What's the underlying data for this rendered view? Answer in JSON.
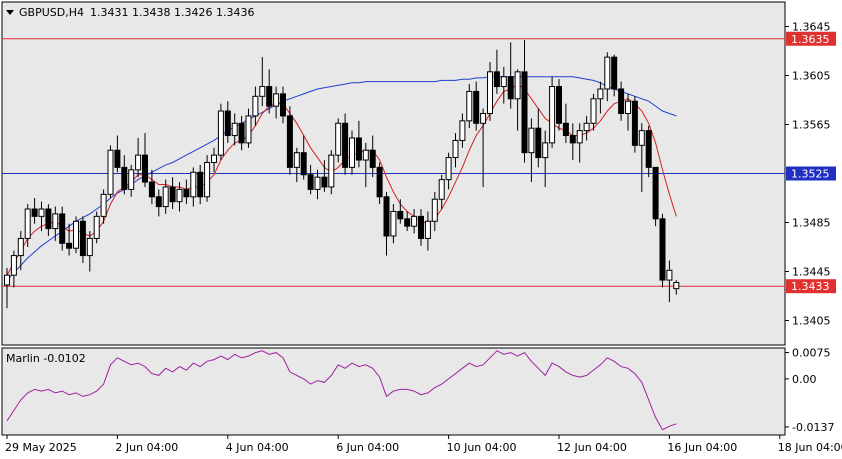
{
  "header": {
    "symbol": "GBPUSD,H4",
    "ohlc": "1.3431 1.3438 1.3426 1.3436"
  },
  "indicator_label": "Marlin -0.0102",
  "colors": {
    "bull_candle": "#ffffff",
    "bear_candle": "#000000",
    "red_line": "#e03030",
    "blue_line": "#2030c0",
    "ma_slow": "#1f3fd0",
    "ma_fast": "#d42020",
    "oscillator": "#a020a0"
  },
  "chart_data": [
    {
      "type": "candlestick",
      "title": "GBPUSD,H4",
      "ylim": [
        1.3385,
        1.3665
      ],
      "y_ticks": [
        "1.3645",
        "1.3605",
        "1.3565",
        "1.3485",
        "1.3445",
        "1.3405"
      ],
      "x_ticks": [
        "29 May 2025",
        "2 Jun 04:00",
        "4 Jun 04:00",
        "6 Jun 04:00",
        "10 Jun 04:00",
        "12 Jun 04:00",
        "16 Jun 04:00",
        "18 Jun 04:00"
      ],
      "x_tick_index": [
        0,
        16,
        32,
        48,
        64,
        80,
        96,
        112
      ],
      "horizontal_lines": [
        {
          "value": 1.3635,
          "label": "1.3635",
          "color": "#e03030"
        },
        {
          "value": 1.3525,
          "label": "1.3525",
          "color": "#2030c0"
        },
        {
          "value": 1.3433,
          "label": "1.3433",
          "color": "#e03030"
        }
      ],
      "candles": [
        [
          1.3434,
          1.3448,
          1.3415,
          1.3442
        ],
        [
          1.3442,
          1.3462,
          1.3432,
          1.3458
        ],
        [
          1.3458,
          1.3478,
          1.3446,
          1.3472
        ],
        [
          1.3472,
          1.35,
          1.3465,
          1.3496
        ],
        [
          1.3496,
          1.3505,
          1.3484,
          1.349
        ],
        [
          1.349,
          1.3502,
          1.3478,
          1.3496
        ],
        [
          1.3496,
          1.35,
          1.3474,
          1.348
        ],
        [
          1.348,
          1.3498,
          1.347,
          1.3492
        ],
        [
          1.3492,
          1.3498,
          1.3462,
          1.3468
        ],
        [
          1.3468,
          1.3484,
          1.3458,
          1.3464
        ],
        [
          1.3464,
          1.349,
          1.346,
          1.3486
        ],
        [
          1.3486,
          1.349,
          1.3452,
          1.3458
        ],
        [
          1.3458,
          1.3478,
          1.3445,
          1.3472
        ],
        [
          1.3472,
          1.3494,
          1.3468,
          1.349
        ],
        [
          1.349,
          1.3512,
          1.3484,
          1.3508
        ],
        [
          1.3508,
          1.3548,
          1.3505,
          1.3544
        ],
        [
          1.3544,
          1.3556,
          1.3526,
          1.353
        ],
        [
          1.353,
          1.354,
          1.3508,
          1.3512
        ],
        [
          1.3512,
          1.3532,
          1.3506,
          1.3528
        ],
        [
          1.3528,
          1.3554,
          1.3522,
          1.354
        ],
        [
          1.354,
          1.3558,
          1.3514,
          1.3518
        ],
        [
          1.3518,
          1.3528,
          1.35,
          1.3506
        ],
        [
          1.3506,
          1.3512,
          1.349,
          1.3498
        ],
        [
          1.3498,
          1.352,
          1.3492,
          1.3514
        ],
        [
          1.3514,
          1.3522,
          1.3496,
          1.3502
        ],
        [
          1.3502,
          1.3518,
          1.3494,
          1.3512
        ],
        [
          1.3512,
          1.352,
          1.35,
          1.3506
        ],
        [
          1.3506,
          1.353,
          1.3498,
          1.3526
        ],
        [
          1.3526,
          1.3532,
          1.35,
          1.3506
        ],
        [
          1.3506,
          1.354,
          1.3502,
          1.3534
        ],
        [
          1.3534,
          1.3546,
          1.3526,
          1.354
        ],
        [
          1.354,
          1.3582,
          1.3536,
          1.3576
        ],
        [
          1.3576,
          1.3584,
          1.355,
          1.3556
        ],
        [
          1.3556,
          1.3574,
          1.3548,
          1.3566
        ],
        [
          1.3566,
          1.3572,
          1.3544,
          1.355
        ],
        [
          1.355,
          1.3578,
          1.3546,
          1.3572
        ],
        [
          1.3572,
          1.3596,
          1.3564,
          1.3588
        ],
        [
          1.3588,
          1.362,
          1.358,
          1.3596
        ],
        [
          1.3596,
          1.361,
          1.3574,
          1.358
        ],
        [
          1.358,
          1.3596,
          1.357,
          1.359
        ],
        [
          1.359,
          1.3596,
          1.3566,
          1.3572
        ],
        [
          1.3572,
          1.358,
          1.3524,
          1.353
        ],
        [
          1.353,
          1.3546,
          1.3518,
          1.3542
        ],
        [
          1.3542,
          1.3556,
          1.352,
          1.3524
        ],
        [
          1.3524,
          1.3532,
          1.3508,
          1.3512
        ],
        [
          1.3512,
          1.3528,
          1.3504,
          1.3522
        ],
        [
          1.3522,
          1.3536,
          1.351,
          1.3514
        ],
        [
          1.3514,
          1.3544,
          1.3508,
          1.354
        ],
        [
          1.354,
          1.357,
          1.3534,
          1.3566
        ],
        [
          1.3566,
          1.3574,
          1.3524,
          1.353
        ],
        [
          1.353,
          1.356,
          1.3524,
          1.3554
        ],
        [
          1.3554,
          1.3568,
          1.353,
          1.3536
        ],
        [
          1.3536,
          1.355,
          1.3514,
          1.3544
        ],
        [
          1.3544,
          1.3556,
          1.3522,
          1.353
        ],
        [
          1.353,
          1.3534,
          1.35,
          1.3506
        ],
        [
          1.3506,
          1.351,
          1.3458,
          1.3474
        ],
        [
          1.3474,
          1.35,
          1.3468,
          1.3494
        ],
        [
          1.3494,
          1.3504,
          1.3484,
          1.3488
        ],
        [
          1.3488,
          1.3494,
          1.3478,
          1.3482
        ],
        [
          1.3482,
          1.3496,
          1.3476,
          1.349
        ],
        [
          1.349,
          1.3496,
          1.3466,
          1.3472
        ],
        [
          1.3472,
          1.3494,
          1.3462,
          1.3486
        ],
        [
          1.3486,
          1.351,
          1.3478,
          1.3504
        ],
        [
          1.3504,
          1.3524,
          1.3496,
          1.352
        ],
        [
          1.352,
          1.3542,
          1.3512,
          1.3538
        ],
        [
          1.3538,
          1.3558,
          1.353,
          1.3552
        ],
        [
          1.3552,
          1.3574,
          1.3546,
          1.3568
        ],
        [
          1.3568,
          1.3598,
          1.3562,
          1.3592
        ],
        [
          1.3592,
          1.36,
          1.356,
          1.3566
        ],
        [
          1.3566,
          1.3578,
          1.3514,
          1.3574
        ],
        [
          1.3574,
          1.3616,
          1.3568,
          1.3608
        ],
        [
          1.3608,
          1.3626,
          1.359,
          1.3596
        ],
        [
          1.3596,
          1.3612,
          1.3582,
          1.3604
        ],
        [
          1.3604,
          1.3632,
          1.3578,
          1.3586
        ],
        [
          1.3586,
          1.361,
          1.356,
          1.3608
        ],
        [
          1.3608,
          1.3634,
          1.3534,
          1.3542
        ],
        [
          1.3542,
          1.357,
          1.3518,
          1.3562
        ],
        [
          1.3562,
          1.3578,
          1.353,
          1.3538
        ],
        [
          1.3538,
          1.356,
          1.3514,
          1.355
        ],
        [
          1.355,
          1.3604,
          1.3546,
          1.3596
        ],
        [
          1.3596,
          1.3602,
          1.356,
          1.3566
        ],
        [
          1.3566,
          1.3582,
          1.355,
          1.3556
        ],
        [
          1.3556,
          1.3566,
          1.3536,
          1.355
        ],
        [
          1.355,
          1.3566,
          1.3534,
          1.356
        ],
        [
          1.356,
          1.3572,
          1.3552,
          1.3566
        ],
        [
          1.3566,
          1.359,
          1.356,
          1.3586
        ],
        [
          1.3586,
          1.36,
          1.3574,
          1.3594
        ],
        [
          1.3594,
          1.3624,
          1.3584,
          1.362
        ],
        [
          1.362,
          1.3622,
          1.3588,
          1.3594
        ],
        [
          1.3594,
          1.36,
          1.3568,
          1.3574
        ],
        [
          1.3574,
          1.359,
          1.356,
          1.3584
        ],
        [
          1.3584,
          1.3588,
          1.3542,
          1.3548
        ],
        [
          1.3548,
          1.3566,
          1.351,
          1.356
        ],
        [
          1.356,
          1.3564,
          1.3522,
          1.353
        ],
        [
          1.353,
          1.3524,
          1.3482,
          1.3488
        ],
        [
          1.3488,
          1.3492,
          1.3432,
          1.3438
        ],
        [
          1.3438,
          1.3454,
          1.342,
          1.3446
        ],
        [
          1.3431,
          1.3438,
          1.3426,
          1.3436
        ]
      ],
      "ma_slow": [
        1.3438,
        1.3444,
        1.345,
        1.3456,
        1.3461,
        1.3466,
        1.347,
        1.3474,
        1.3478,
        1.3482,
        1.3486,
        1.3489,
        1.3492,
        1.3496,
        1.35,
        1.3505,
        1.3509,
        1.3512,
        1.3516,
        1.352,
        1.3523,
        1.3526,
        1.3529,
        1.3532,
        1.3534,
        1.3537,
        1.354,
        1.3543,
        1.3546,
        1.3549,
        1.3552,
        1.3556,
        1.356,
        1.3563,
        1.3566,
        1.3569,
        1.3572,
        1.3575,
        1.3578,
        1.3581,
        1.3584,
        1.3586,
        1.3588,
        1.359,
        1.3592,
        1.3594,
        1.3595,
        1.3596,
        1.3597,
        1.3598,
        1.3599,
        1.3599,
        1.36,
        1.36,
        1.36,
        1.36,
        1.36,
        1.36,
        1.36,
        1.36,
        1.36,
        1.36,
        1.36,
        1.3601,
        1.3601,
        1.3601,
        1.3602,
        1.3602,
        1.3603,
        1.3603,
        1.3604,
        1.3604,
        1.3604,
        1.3604,
        1.3604,
        1.3604,
        1.3604,
        1.3604,
        1.3604,
        1.3604,
        1.3604,
        1.3604,
        1.3604,
        1.3603,
        1.3602,
        1.3601,
        1.3599,
        1.3596,
        1.3594,
        1.3592,
        1.359,
        1.3588,
        1.3586,
        1.3584,
        1.358,
        1.3576,
        1.3574,
        1.3572
      ],
      "ma_fast": [
        1.3442,
        1.3452,
        1.3462,
        1.3472,
        1.3478,
        1.3482,
        1.3484,
        1.3486,
        1.3482,
        1.3478,
        1.3479,
        1.3476,
        1.3474,
        1.3478,
        1.3486,
        1.35,
        1.351,
        1.3514,
        1.3518,
        1.3524,
        1.3524,
        1.352,
        1.3516,
        1.3516,
        1.3514,
        1.3514,
        1.3512,
        1.3514,
        1.3514,
        1.3518,
        1.3524,
        1.3536,
        1.3544,
        1.355,
        1.3552,
        1.3556,
        1.3564,
        1.3574,
        1.358,
        1.3582,
        1.3582,
        1.3574,
        1.3566,
        1.3556,
        1.3546,
        1.3538,
        1.353,
        1.3526,
        1.353,
        1.3536,
        1.354,
        1.3542,
        1.3544,
        1.3544,
        1.3536,
        1.3522,
        1.351,
        1.35,
        1.3494,
        1.349,
        1.3486,
        1.3484,
        1.3488,
        1.3496,
        1.3506,
        1.3518,
        1.353,
        1.3544,
        1.3556,
        1.3564,
        1.3574,
        1.3584,
        1.3592,
        1.3594,
        1.3598,
        1.3594,
        1.3586,
        1.3578,
        1.357,
        1.3566,
        1.3562,
        1.356,
        1.3556,
        1.3556,
        1.3558,
        1.3562,
        1.3568,
        1.3576,
        1.3582,
        1.3584,
        1.3586,
        1.3582,
        1.3576,
        1.3566,
        1.355,
        1.3528,
        1.3508,
        1.349
      ],
      "oscillator": {
        "label": "Marlin -0.0102",
        "y_ticks": [
          "0.0075",
          "0.00",
          "-0.0137"
        ],
        "ylim": [
          -0.016,
          0.0088
        ],
        "values": [
          -0.012,
          -0.009,
          -0.006,
          -0.004,
          -0.003,
          -0.0035,
          -0.003,
          -0.004,
          -0.0035,
          -0.0045,
          -0.004,
          -0.005,
          -0.0045,
          -0.0035,
          -0.0015,
          0.004,
          0.006,
          0.005,
          0.004,
          0.0045,
          0.0035,
          0.0015,
          0.001,
          0.003,
          0.002,
          0.0035,
          0.0025,
          0.0045,
          0.0035,
          0.005,
          0.0055,
          0.0065,
          0.0055,
          0.007,
          0.006,
          0.0065,
          0.0075,
          0.008,
          0.007,
          0.0075,
          0.006,
          0.002,
          0.001,
          0.0,
          -0.0015,
          -0.0005,
          -0.001,
          0.001,
          0.004,
          0.003,
          0.0045,
          0.0035,
          0.004,
          0.003,
          0.0005,
          -0.005,
          -0.0035,
          -0.003,
          -0.003,
          -0.0035,
          -0.0045,
          -0.004,
          -0.0025,
          -0.0015,
          0.0,
          0.0015,
          0.003,
          0.0045,
          0.0035,
          0.004,
          0.006,
          0.008,
          0.007,
          0.0075,
          0.0065,
          0.0075,
          0.005,
          0.003,
          0.001,
          0.0045,
          0.0035,
          0.002,
          0.001,
          0.0005,
          0.001,
          0.0025,
          0.004,
          0.006,
          0.005,
          0.0035,
          0.003,
          0.0015,
          -0.001,
          -0.006,
          -0.011,
          -0.0145,
          -0.0135,
          -0.0128
        ]
      }
    }
  ]
}
